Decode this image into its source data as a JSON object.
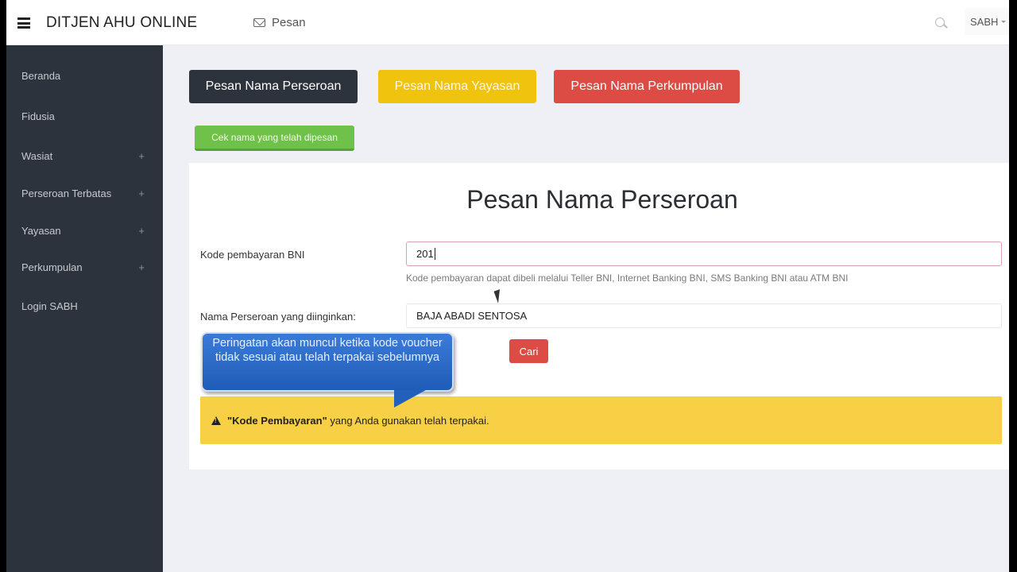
{
  "header": {
    "brand": "DITJEN AHU ONLINE",
    "nav_pesan": "Pesan",
    "user_menu": "SABH",
    "icons": {
      "menu": "hamburger-icon",
      "mail": "envelope-icon",
      "search": "search-icon",
      "caret": "caret-down-icon"
    }
  },
  "sidebar": {
    "items": [
      {
        "label": "Beranda",
        "expandable": false
      },
      {
        "label": "Fidusia",
        "expandable": false
      },
      {
        "label": "Wasiat",
        "expandable": true,
        "toggle": "+"
      },
      {
        "label": "Perseroan Terbatas",
        "expandable": true,
        "toggle": "+"
      },
      {
        "label": "Yayasan",
        "expandable": true,
        "toggle": "+"
      },
      {
        "label": "Perkumpulan",
        "expandable": true,
        "toggle": "+"
      },
      {
        "label": "Login SABH",
        "expandable": false
      }
    ]
  },
  "actions": {
    "perseroan": "Pesan Nama Perseroan",
    "yayasan": "Pesan Nama Yayasan",
    "perkumpulan": "Pesan Nama Perkumpulan",
    "cek_nama": "Cek nama yang telah dipesan"
  },
  "form": {
    "title": "Pesan Nama Perseroan",
    "kode_label": "Kode pembayaran BNI",
    "kode_value": "201",
    "kode_help": "Kode pembayaran dapat dibeli melalui Teller BNI, Internet Banking BNI, SMS Banking BNI atau ATM BNI",
    "nama_label": "Nama Perseroan yang diinginkan:",
    "nama_value": "BAJA ABADI SENTOSA",
    "search_button": "Cari"
  },
  "alert": {
    "icon": "warning-icon",
    "bold": "\"Kode Pembayaran\"",
    "text": " yang Anda gunakan telah terpakai."
  },
  "callout": {
    "text": "Peringatan akan muncul ketika kode voucher tidak sesuai atau telah terpakai sebelumnya"
  },
  "colors": {
    "sidebar": "#2d333d",
    "primary_dark": "#2d333d",
    "yellow": "#f0c30f",
    "red": "#dd4b45",
    "green": "#6fc14a",
    "alert": "#f7d046",
    "callout": "#2a68c8"
  }
}
